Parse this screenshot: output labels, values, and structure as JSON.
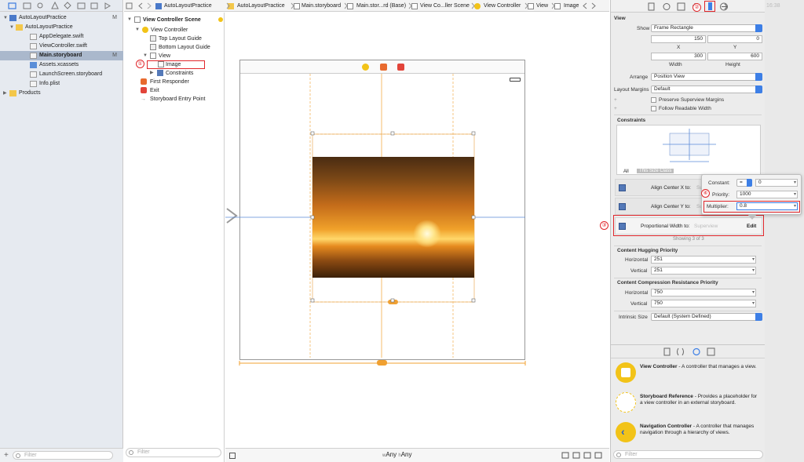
{
  "navigator": {
    "items": [
      {
        "label": "AutoLayoutPractice",
        "mark": "M",
        "icon": "project-icon"
      },
      {
        "label": "AutoLayoutPractice",
        "mark": "",
        "icon": "folder-icon"
      },
      {
        "label": "AppDelegate.swift",
        "mark": "",
        "icon": "swift-file-icon"
      },
      {
        "label": "ViewController.swift",
        "mark": "",
        "icon": "swift-file-icon"
      },
      {
        "label": "Main.storyboard",
        "mark": "M",
        "icon": "storyboard-file-icon"
      },
      {
        "label": "Assets.xcassets",
        "mark": "",
        "icon": "assets-icon"
      },
      {
        "label": "LaunchScreen.storyboard",
        "mark": "",
        "icon": "storyboard-file-icon"
      },
      {
        "label": "Info.plist",
        "mark": "",
        "icon": "plist-icon"
      },
      {
        "label": "Products",
        "mark": "",
        "icon": "folder-icon"
      }
    ],
    "filter_placeholder": "Filter"
  },
  "jumpbar": {
    "crumbs": [
      "AutoLayoutPractice",
      "AutoLayoutPractice",
      "Main.storyboard",
      "Main.stor...rd (Base)",
      "View Co...ller Scene",
      "View Controller",
      "View",
      "Image"
    ]
  },
  "outline": {
    "items": [
      "View Controller Scene",
      "View Controller",
      "Top Layout Guide",
      "Bottom Layout Guide",
      "View",
      "Image",
      "Constraints",
      "First Responder",
      "Exit",
      "Storyboard Entry Point"
    ],
    "filter_placeholder": "Filter"
  },
  "canvas": {
    "size_class_w": "Any",
    "size_class_h": "Any",
    "w_prefix": "w",
    "h_prefix": "h"
  },
  "annotations": {
    "n1": "①",
    "n2": "②",
    "n3": "③",
    "n4": "④"
  },
  "status": {
    "clock": "16:38"
  },
  "inspector": {
    "section_view": "View",
    "show_label": "Show",
    "show_value": "Frame Rectangle",
    "x": "150",
    "y": "0",
    "x_label": "X",
    "y_label": "Y",
    "width": "300",
    "height": "600",
    "width_label": "Width",
    "height_label": "Height",
    "arrange_label": "Arrange",
    "arrange_value": "Position View",
    "margins_label": "Layout Margins",
    "margins_value": "Default",
    "preserve_label": "Preserve Superview Margins",
    "readable_label": "Follow Readable Width",
    "constraints_label": "Constraints",
    "tab_all": "All",
    "tab_size": "This Size Class",
    "constraints": [
      {
        "label": "Align Center X to:",
        "target": "Su"
      },
      {
        "label": "Align Center Y to:",
        "target": "Su"
      },
      {
        "label": "Proportional Width to:",
        "target": "Superview",
        "edit": "Edit"
      }
    ],
    "showing": "Showing 3 of 3",
    "hugging_label": "Content Hugging Priority",
    "horizontal_label": "Horizontal",
    "vertical_label": "Vertical",
    "hug_h": "251",
    "hug_v": "251",
    "compression_label": "Content Compression Resistance Priority",
    "comp_h": "750",
    "comp_v": "750",
    "intrinsic_label": "Intrinsic Size",
    "intrinsic_value": "Default (System Defined)"
  },
  "popover": {
    "constant_label": "Constant:",
    "constant_rel": "=",
    "constant_value": "0",
    "priority_label": "Priority:",
    "priority_value": "1000",
    "multiplier_label": "Multiplier:",
    "multiplier_value": "0.8"
  },
  "library": {
    "items": [
      {
        "title": "View Controller",
        "desc": " - A controller that manages a view.",
        "icon": "view-controller-icon"
      },
      {
        "title": "Storyboard Reference",
        "desc": " - Provides a placeholder for a view controller in an external storyboard.",
        "icon": "storyboard-reference-icon"
      },
      {
        "title": "Navigation Controller",
        "desc": " - A controller that manages navigation through a hierarchy of views.",
        "icon": "navigation-controller-icon"
      }
    ],
    "filter_placeholder": "Filter"
  },
  "colors": {
    "accent": "#3d7fe6",
    "annotation": "#e0262b",
    "constraint": "#f0a030",
    "sky": "#e08a20"
  }
}
